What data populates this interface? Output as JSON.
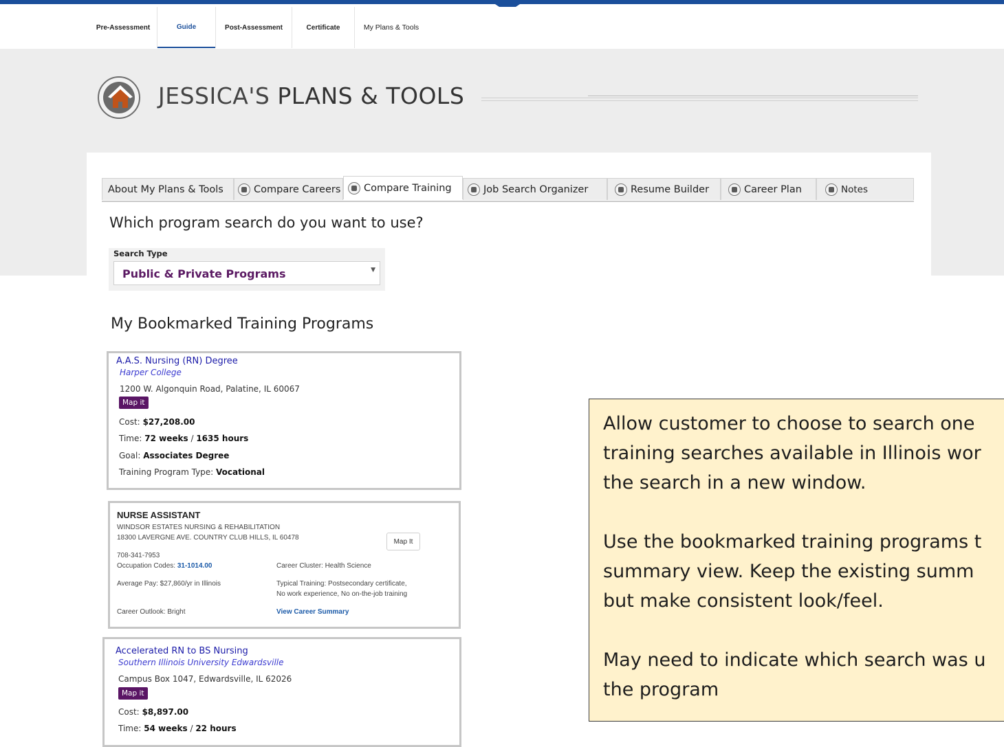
{
  "top_nav": {
    "pre_assessment": "Pre-Assessment",
    "guide": "Guide",
    "post_assessment": "Post-Assessment",
    "certificate": "Certificate",
    "my_plans_tools": "My Plans & Tools"
  },
  "header": {
    "title_lead": "JESSICA'S",
    "title_rest": "PLANS & TOOLS"
  },
  "tabs": [
    {
      "label": "About My Plans & Tools"
    },
    {
      "label": "Compare Careers"
    },
    {
      "label": "Compare Training"
    },
    {
      "label": "Job Search Organizer"
    },
    {
      "label": "Resume Builder"
    },
    {
      "label": "Career Plan"
    },
    {
      "label": "Notes"
    }
  ],
  "search": {
    "question": "Which program search do you want to use?",
    "label": "Search Type",
    "selected": "Public & Private Programs"
  },
  "bookmarks": {
    "heading": "My Bookmarked Training Programs",
    "card1": {
      "title": "A.A.S. Nursing (RN) Degree",
      "school": "Harper College",
      "address": "1200 W. Algonquin Road, Palatine, IL 60067",
      "map": "Map it",
      "cost_label": "Cost:",
      "cost": "$27,208.00",
      "time_label": "Time:",
      "time_weeks": "72 weeks",
      "time_sep": "/",
      "time_hours": "1635 hours",
      "goal_label": "Goal:",
      "goal": "Associates Degree",
      "type_label": "Training Program Type:",
      "type": "Vocational"
    },
    "card2": {
      "title": "NURSE ASSISTANT",
      "org": "WINDSOR ESTATES NURSING & REHABILITATION",
      "address": "18300 LAVERGNE AVE. COUNTRY CLUB HILLS, IL 60478",
      "map": "Map It",
      "phone": "708-341-7953",
      "occ_label": "Occupation Codes:",
      "occ_code": "31-1014.00",
      "cluster": "Career Cluster: Health Science",
      "pay": "Average Pay: $27,860/yr in Illinois",
      "training_1": "Typical Training: Postsecondary certificate,",
      "training_2": "No work experience, No on-the-job training",
      "outlook": "Career Outlook: Bright",
      "summary_link": "View Career Summary"
    },
    "card3": {
      "title": "Accelerated RN to BS Nursing",
      "school": "Southern Illinois University Edwardsville",
      "address": "Campus Box 1047, Edwardsville, IL 62026",
      "map": "Map it",
      "cost_label": "Cost:",
      "cost": "$8,897.00",
      "time_label": "Time:",
      "time_weeks": "54 weeks",
      "time_sep": "/",
      "time_hours": "22 hours"
    }
  },
  "callout": {
    "p1_l1": "Allow customer to choose to search one",
    "p1_l2": "training searches available in Illinois wor",
    "p1_l3": "the search in a new window.",
    "p2_l1": "Use the bookmarked training programs t",
    "p2_l2": "summary view.  Keep the existing summ",
    "p2_l3": "but make consistent look/feel.",
    "p3_l1": "May need to indicate which search was u",
    "p3_l2": "the program"
  },
  "colors": {
    "brand_blue": "#1b4f9b",
    "accent_purple": "#5a1565",
    "link_blue": "#1a1aa8",
    "callout_bg": "#fff2cc"
  }
}
